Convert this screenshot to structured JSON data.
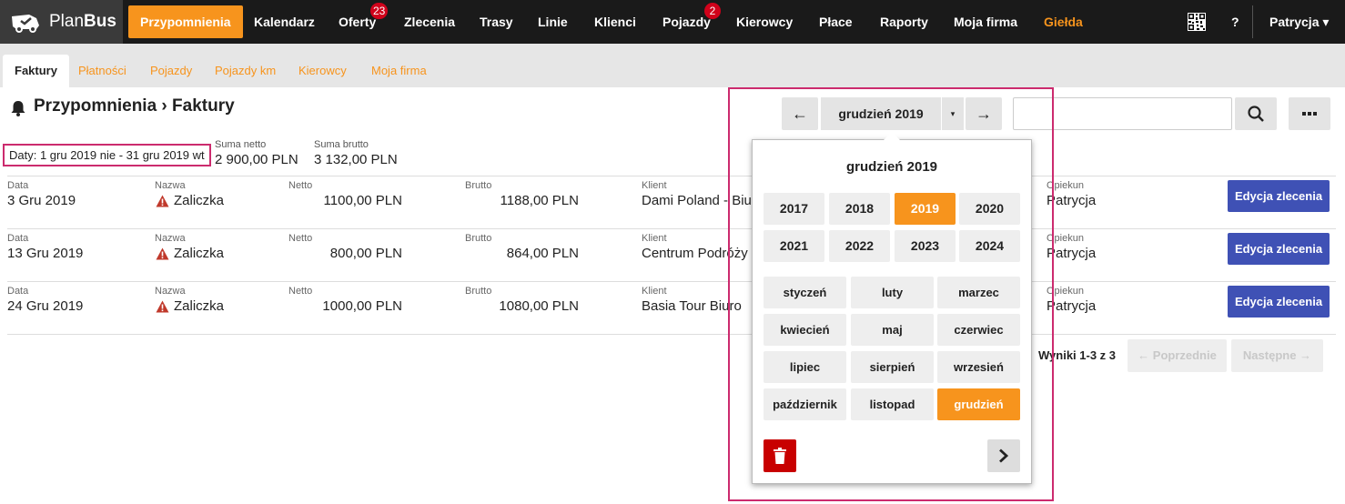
{
  "app": {
    "logo_plain": "Plan",
    "logo_bold": "Bus"
  },
  "nav": {
    "przypomnienia": "Przypomnienia",
    "kalendarz": "Kalendarz",
    "oferty": "Oferty",
    "oferty_badge": "23",
    "zlecenia": "Zlecenia",
    "trasy": "Trasy",
    "linie": "Linie",
    "klienci": "Klienci",
    "pojazdy": "Pojazdy",
    "pojazdy_badge": "2",
    "kierowcy": "Kierowcy",
    "place": "Płace",
    "raporty": "Raporty",
    "moja_firma": "Moja firma",
    "gielda": "Giełda",
    "help": "?",
    "user": "Patrycja ▾"
  },
  "subtabs": {
    "faktury": "Faktury",
    "platnosci": "Płatności",
    "pojazdy": "Pojazdy",
    "pojazdy_km": "Pojazdy km",
    "kierowcy": "Kierowcy",
    "moja_firma": "Moja firma"
  },
  "page": {
    "title": "Przypomnienia › Faktury"
  },
  "summary": {
    "dates": "Daty: 1 gru 2019 nie - 31 gru 2019 wt",
    "netto_label": "Suma netto",
    "netto_value": "2 900,00 PLN",
    "brutto_label": "Suma brutto",
    "brutto_value": "3 132,00 PLN"
  },
  "columns": {
    "data": "Data",
    "nazwa": "Nazwa",
    "netto": "Netto",
    "brutto": "Brutto",
    "klient": "Klient",
    "opiekun": "Opiekun"
  },
  "rows": [
    {
      "data": "3 Gru 2019",
      "nazwa": "Zaliczka",
      "netto": "1100,00 PLN",
      "brutto": "1188,00 PLN",
      "klient": "Dami Poland - Biu",
      "opiekun": "Patrycja",
      "action": "Edycja zlecenia"
    },
    {
      "data": "13 Gru 2019",
      "nazwa": "Zaliczka",
      "netto": "800,00 PLN",
      "brutto": "864,00 PLN",
      "klient": "Centrum Podróży",
      "opiekun": "Patrycja",
      "action": "Edycja zlecenia"
    },
    {
      "data": "24 Gru 2019",
      "nazwa": "Zaliczka",
      "netto": "1000,00 PLN",
      "brutto": "1080,00 PLN",
      "klient": "Basia Tour Biuro",
      "opiekun": "Patrycja",
      "action": "Edycja zlecenia"
    }
  ],
  "pagination": {
    "results": "Wyniki 1-3 z 3",
    "prev": "← Poprzednie",
    "next": "Następne →"
  },
  "month_picker": {
    "current": "grudzień 2019",
    "prev_arrow": "←",
    "next_arrow": "→",
    "caret": "▾",
    "popup_title": "grudzień 2019",
    "years": [
      "2017",
      "2018",
      "2019",
      "2020",
      "2021",
      "2022",
      "2023",
      "2024"
    ],
    "selected_year": "2019",
    "months": [
      "styczeń",
      "luty",
      "marzec",
      "kwiecień",
      "maj",
      "czerwiec",
      "lipiec",
      "sierpień",
      "wrzesień",
      "październik",
      "listopad",
      "grudzień"
    ],
    "selected_month": "grudzień"
  },
  "search": {
    "value": "",
    "placeholder": ""
  },
  "colors": {
    "accent": "#f7941d",
    "nav_bg": "#1a1a1a",
    "edit_button": "#3f51b5",
    "badge": "#d0021b",
    "highlight": "#cc2b6e",
    "delete": "#c80000"
  }
}
